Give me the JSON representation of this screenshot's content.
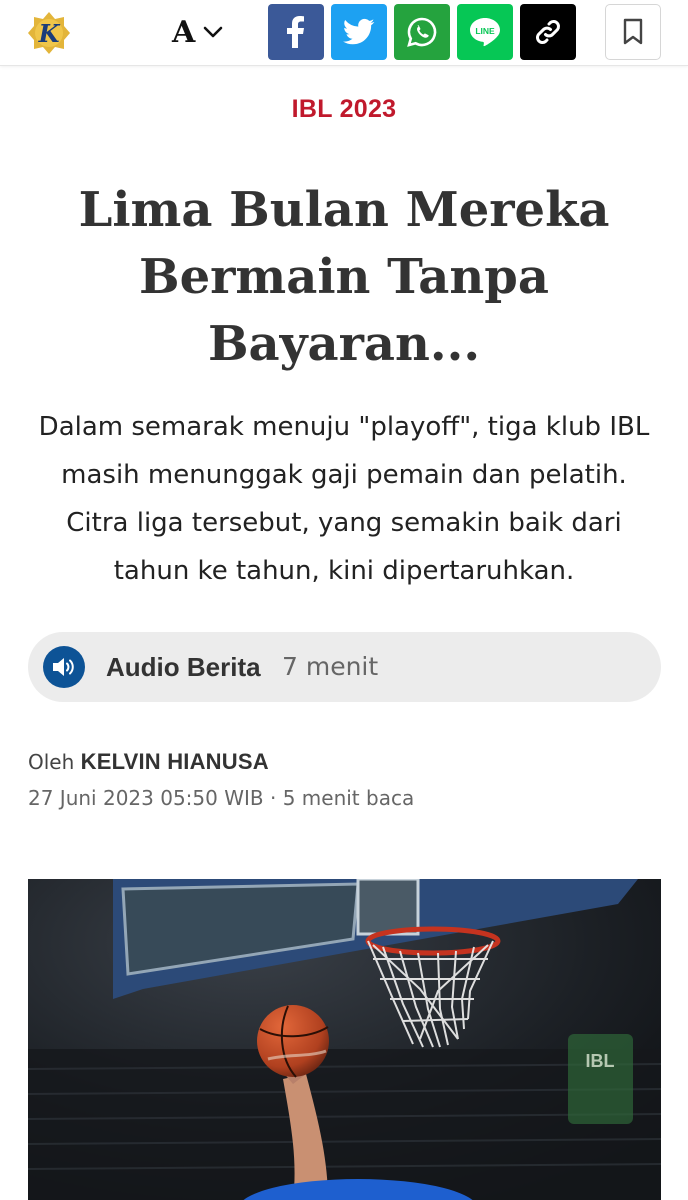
{
  "toolbar": {
    "logo_letter": "K",
    "font_size_letter": "A",
    "icons": [
      "kompas-logo-icon",
      "chevron-down-icon",
      "facebook-icon",
      "twitter-icon",
      "whatsapp-icon",
      "line-icon",
      "copy-link-icon",
      "bookmark-icon"
    ],
    "share_colors": {
      "facebook": "#3b5998",
      "twitter": "#1da1f2",
      "whatsapp": "#25a33e",
      "line": "#06c755",
      "copy": "#000000"
    },
    "line_badge_text": "LINE"
  },
  "article": {
    "kicker": "IBL 2023",
    "headline_lines": [
      "Lima Bulan Mereka",
      "Bermain Tanpa",
      "Bayaran..."
    ],
    "lead_lines": [
      "Dalam semarak menuju \"playoff\", tiga klub IBL",
      "masih menunggak gaji pemain dan pelatih.",
      "Citra liga tersebut, yang semakin baik dari",
      "tahun ke tahun, kini dipertaruhkan."
    ],
    "kicker_color": "#c0192c"
  },
  "audio": {
    "label": "Audio Berita",
    "duration": "7 menit",
    "icon": "speaker-icon",
    "accent": "#0d5396"
  },
  "byline": {
    "prefix": "Oleh",
    "author": "KELVIN HIANUSA",
    "timestamp": "27 Juni 2023 05:50 WIB",
    "separator": "·",
    "read_time": "5 menit baca"
  },
  "hero_image": {
    "subject": "basketball-hoop-photo",
    "banner_text": "IBL"
  }
}
